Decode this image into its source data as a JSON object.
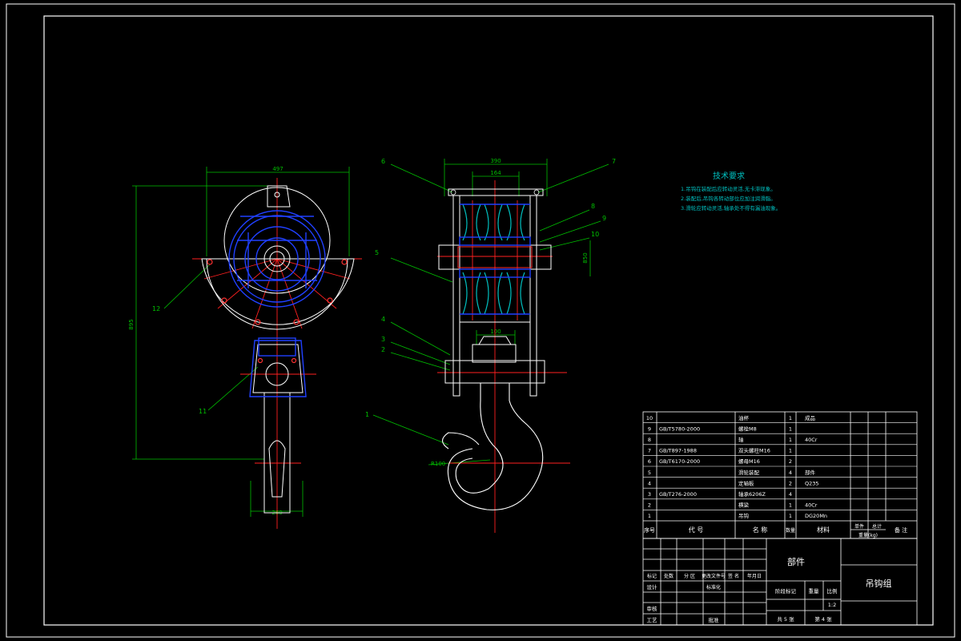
{
  "dimensions": {
    "front_width": "497",
    "front_height": "895",
    "front_bottom": "260",
    "side_top": "390",
    "side_inner": "164",
    "side_mid": "100",
    "side_pitch": "850",
    "hook_radius": "R100"
  },
  "balloons": {
    "b12": "12",
    "b11": "11",
    "b6": "6",
    "b5": "5",
    "b4": "4",
    "b3": "3",
    "b2": "2",
    "b1": "1",
    "b7": "7",
    "b8": "8",
    "b9": "9",
    "b10": "10"
  },
  "tech_req": {
    "title": "技术要求",
    "line1": "1.吊钩在装配后应转动灵活,无卡滞现象。",
    "line2": "2.装配后,吊钩各转动部位应加注润滑脂。",
    "line3": "3.滑轮应转动灵活,轴承处不得有漏油现象。"
  },
  "bom": {
    "rows": [
      {
        "no": "10",
        "code": "",
        "name": "油杯",
        "qty": "1",
        "mat": "成品"
      },
      {
        "no": "9",
        "code": "GB/T5780-2000",
        "name": "螺栓M8",
        "qty": "1",
        "mat": ""
      },
      {
        "no": "8",
        "code": "",
        "name": "轴",
        "qty": "1",
        "mat": "40Cr"
      },
      {
        "no": "7",
        "code": "GB/T897-1988",
        "name": "双头螺柱M16",
        "qty": "1",
        "mat": ""
      },
      {
        "no": "6",
        "code": "GB/T6170-2000",
        "name": "螺母M16",
        "qty": "2",
        "mat": ""
      },
      {
        "no": "5",
        "code": "",
        "name": "滑轮装配",
        "qty": "4",
        "mat": "部件"
      },
      {
        "no": "4",
        "code": "",
        "name": "定轴板",
        "qty": "2",
        "mat": "Q235"
      },
      {
        "no": "3",
        "code": "GB/T276-2000",
        "name": "轴承6206Z",
        "qty": "4",
        "mat": ""
      },
      {
        "no": "2",
        "code": "",
        "name": "横梁",
        "qty": "1",
        "mat": "40Cr"
      },
      {
        "no": "1",
        "code": "",
        "name": "吊钩",
        "qty": "1",
        "mat": "DG20Mn"
      }
    ],
    "header": {
      "no": "序号",
      "code": "代  号",
      "name": "名    称",
      "qty": "数量",
      "mat": "材料",
      "weight1": "单件",
      "weight2": "总计",
      "weight_label": "重量(kg)",
      "remark": "备  注"
    }
  },
  "title_block": {
    "part_label": "部件",
    "drawing_name": "吊钩组",
    "rev_marks": "标记",
    "rev_count": "处数",
    "rev_zone": "分 区",
    "rev_doc": "更改文件号",
    "rev_sign": "签 名",
    "rev_date": "年月日",
    "design": "设计",
    "standardize": "标准化",
    "review": "审核",
    "process": "工艺",
    "approve": "批准",
    "stage": "阶段标记",
    "weight": "重量",
    "scale": "比例",
    "scale_value": "1:2",
    "sheets_total": "共 5 张",
    "sheet_no": "第 4 张"
  }
}
